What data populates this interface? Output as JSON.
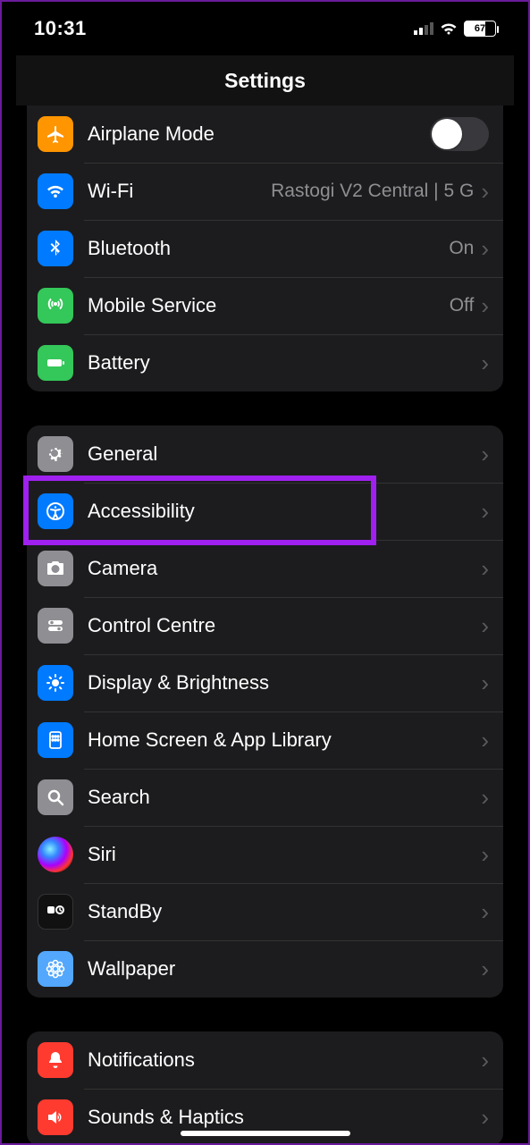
{
  "status": {
    "time": "10:31",
    "battery_pct": "67"
  },
  "header": {
    "title": "Settings"
  },
  "group1": {
    "airplane": {
      "label": "Airplane Mode",
      "on": false
    },
    "wifi": {
      "label": "Wi-Fi",
      "value": "Rastogi V2 Central |  5 G"
    },
    "bluetooth": {
      "label": "Bluetooth",
      "value": "On"
    },
    "mobile": {
      "label": "Mobile Service",
      "value": "Off"
    },
    "battery": {
      "label": "Battery"
    }
  },
  "group2": {
    "general": {
      "label": "General"
    },
    "accessibility": {
      "label": "Accessibility"
    },
    "camera": {
      "label": "Camera"
    },
    "control": {
      "label": "Control Centre"
    },
    "display": {
      "label": "Display & Brightness"
    },
    "home": {
      "label": "Home Screen & App Library"
    },
    "search": {
      "label": "Search"
    },
    "siri": {
      "label": "Siri"
    },
    "standby": {
      "label": "StandBy"
    },
    "wallpaper": {
      "label": "Wallpaper"
    }
  },
  "group3": {
    "notifications": {
      "label": "Notifications"
    },
    "sounds": {
      "label": "Sounds & Haptics"
    }
  },
  "highlight": {
    "target": "accessibility"
  }
}
